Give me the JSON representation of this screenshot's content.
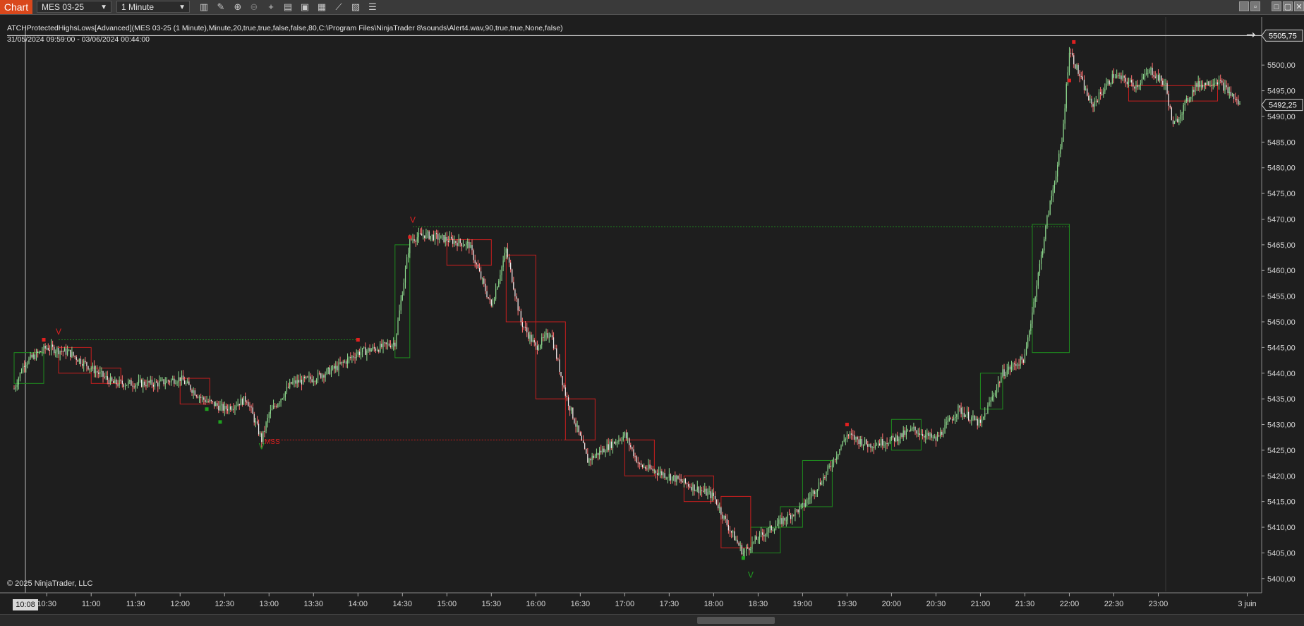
{
  "toolbar": {
    "tab_label": "Chart",
    "instrument": "MES 03-25",
    "interval": "1 Minute",
    "icons": [
      "bar-type-icon",
      "draw-pencil-icon",
      "zoom-in-icon",
      "zoom-out-icon",
      "crosshair-icon",
      "data-box-icon",
      "properties-icon",
      "indicators-icon",
      "strategies-icon",
      "templates-icon",
      "chart-trader-icon"
    ],
    "window_buttons": [
      "minimize-icon",
      "restore-icon",
      "maximize-icon",
      "close-icon"
    ]
  },
  "indicator_label": "ATCHProtectedHighsLows[Advanced](MES 03-25 (1 Minute),Minute,20,true,true,false,false,80,C:\\Program Files\\NinjaTrader 8\\sounds\\Alert4.wav,90,true,true,None,false)",
  "range_label": "31/05/2024 09:59:00 - 03/06/2024 00:44:00",
  "copyright": "© 2025 NinjaTrader, LLC",
  "cursor_time": "10:08",
  "colors": {
    "background": "#1e1e1e",
    "grid": "#2c2c2c",
    "up_candle": "#8fdc8f",
    "down_candle": "#f0f0f0",
    "bull_box": "#1e8c1e",
    "bear_box": "#c81e1e",
    "marker_red": "#e02020",
    "marker_green": "#20a020"
  },
  "chart_data": {
    "type": "candlestick",
    "x_ticks": [
      "10:30",
      "11:00",
      "11:30",
      "12:00",
      "12:30",
      "13:00",
      "13:30",
      "14:00",
      "14:30",
      "15:00",
      "15:30",
      "16:00",
      "16:30",
      "17:00",
      "17:30",
      "18:00",
      "18:30",
      "19:00",
      "19:30",
      "20:00",
      "20:30",
      "21:00",
      "21:30",
      "22:00",
      "22:30",
      "23:00",
      "3 juin"
    ],
    "x_start": "10:08",
    "y_ticks": [
      5400,
      5405,
      5410,
      5415,
      5420,
      5425,
      5430,
      5435,
      5440,
      5445,
      5450,
      5455,
      5460,
      5465,
      5470,
      5475,
      5480,
      5485,
      5490,
      5495,
      5500
    ],
    "y_tick_labels": [
      "5400,00",
      "5405,00",
      "5410,00",
      "5415,00",
      "5420,00",
      "5425,00",
      "5430,00",
      "5435,00",
      "5440,00",
      "5445,00",
      "5450,00",
      "5455,00",
      "5460,00",
      "5465,00",
      "5470,00",
      "5475,00",
      "5480,00",
      "5485,00",
      "5490,00",
      "5495,00",
      "5500,00"
    ],
    "ylim": [
      5397.5,
      5508
    ],
    "price_markers": [
      {
        "label": "5505,75",
        "value": 5505.75
      },
      {
        "label": "5492,25",
        "value": 5492.25
      }
    ],
    "price_path": [
      [
        "10:08",
        5437
      ],
      [
        "10:15",
        5442
      ],
      [
        "10:30",
        5445
      ],
      [
        "10:45",
        5444
      ],
      [
        "11:00",
        5441
      ],
      [
        "11:15",
        5438
      ],
      [
        "11:30",
        5438
      ],
      [
        "11:45",
        5438
      ],
      [
        "12:00",
        5439
      ],
      [
        "12:15",
        5435
      ],
      [
        "12:30",
        5433
      ],
      [
        "12:45",
        5435
      ],
      [
        "12:55",
        5427
      ],
      [
        "13:00",
        5432
      ],
      [
        "13:15",
        5438
      ],
      [
        "13:30",
        5439
      ],
      [
        "13:45",
        5441
      ],
      [
        "14:00",
        5444
      ],
      [
        "14:15",
        5445
      ],
      [
        "14:25",
        5446
      ],
      [
        "14:35",
        5466
      ],
      [
        "14:45",
        5467
      ],
      [
        "15:00",
        5466
      ],
      [
        "15:15",
        5465
      ],
      [
        "15:30",
        5453
      ],
      [
        "15:40",
        5464
      ],
      [
        "15:50",
        5450
      ],
      [
        "16:00",
        5445
      ],
      [
        "16:10",
        5448
      ],
      [
        "16:20",
        5436
      ],
      [
        "16:35",
        5423
      ],
      [
        "16:45",
        5425
      ],
      [
        "17:00",
        5428
      ],
      [
        "17:10",
        5422
      ],
      [
        "17:30",
        5420
      ],
      [
        "17:45",
        5418
      ],
      [
        "18:00",
        5416
      ],
      [
        "18:10",
        5410
      ],
      [
        "18:20",
        5405
      ],
      [
        "18:30",
        5408
      ],
      [
        "18:45",
        5411
      ],
      [
        "19:00",
        5414
      ],
      [
        "19:15",
        5420
      ],
      [
        "19:30",
        5428
      ],
      [
        "19:45",
        5426
      ],
      [
        "20:00",
        5427
      ],
      [
        "20:15",
        5429
      ],
      [
        "20:30",
        5427
      ],
      [
        "20:45",
        5433
      ],
      [
        "21:00",
        5430
      ],
      [
        "21:15",
        5440
      ],
      [
        "21:30",
        5443
      ],
      [
        "21:45",
        5470
      ],
      [
        "21:55",
        5485
      ],
      [
        "22:00",
        5503
      ],
      [
        "22:15",
        5492
      ],
      [
        "22:30",
        5498
      ],
      [
        "22:45",
        5496
      ],
      [
        "22:55",
        5499
      ],
      [
        "23:05",
        5496
      ],
      [
        "23:10",
        5488
      ],
      [
        "23:25",
        5496
      ],
      [
        "23:40",
        5497
      ],
      [
        "23:50",
        5494
      ],
      [
        "23:55",
        5492.25
      ]
    ],
    "bull_boxes": [
      {
        "from": "10:08",
        "to": "10:28",
        "low": 5438,
        "high": 5444
      },
      {
        "from": "14:25",
        "to": "14:35",
        "low": 5443,
        "high": 5465
      },
      {
        "from": "18:25",
        "to": "18:45",
        "low": 5405,
        "high": 5410
      },
      {
        "from": "18:45",
        "to": "19:00",
        "low": 5410,
        "high": 5414
      },
      {
        "from": "19:00",
        "to": "19:20",
        "low": 5414,
        "high": 5423
      },
      {
        "from": "20:00",
        "to": "20:20",
        "low": 5425,
        "high": 5431
      },
      {
        "from": "21:00",
        "to": "21:15",
        "low": 5433,
        "high": 5440
      },
      {
        "from": "21:35",
        "to": "22:00",
        "low": 5444,
        "high": 5469
      }
    ],
    "bear_boxes": [
      {
        "from": "10:38",
        "to": "11:00",
        "low": 5440,
        "high": 5445
      },
      {
        "from": "11:00",
        "to": "11:20",
        "low": 5438,
        "high": 5441
      },
      {
        "from": "12:00",
        "to": "12:20",
        "low": 5434,
        "high": 5439
      },
      {
        "from": "15:00",
        "to": "15:30",
        "low": 5461,
        "high": 5466
      },
      {
        "from": "15:40",
        "to": "16:00",
        "low": 5450,
        "high": 5463
      },
      {
        "from": "16:00",
        "to": "16:20",
        "low": 5435,
        "high": 5450
      },
      {
        "from": "16:20",
        "to": "16:40",
        "low": 5427,
        "high": 5435
      },
      {
        "from": "17:00",
        "to": "17:20",
        "low": 5420,
        "high": 5427
      },
      {
        "from": "17:40",
        "to": "18:00",
        "low": 5415,
        "high": 5420
      },
      {
        "from": "18:05",
        "to": "18:25",
        "low": 5406,
        "high": 5416
      },
      {
        "from": "22:40",
        "to": "23:40",
        "low": 5493,
        "high": 5496
      }
    ],
    "levels": [
      {
        "from": "10:38",
        "to": "14:00",
        "value": 5446.5,
        "color": "bull"
      },
      {
        "from": "14:37",
        "to": "22:00",
        "value": 5468.5,
        "color": "bull"
      },
      {
        "from": "12:55",
        "to": "16:20",
        "value": 5427,
        "color": "bear"
      }
    ],
    "annotations": [
      {
        "text": "V",
        "time": "10:38",
        "value": 5447.5,
        "color": "bear"
      },
      {
        "text": "V",
        "time": "14:37",
        "value": 5469.3,
        "color": "bear"
      },
      {
        "text": "V",
        "time": "12:55",
        "value": 5425.2,
        "color": "bull"
      },
      {
        "text": "V",
        "time": "18:25",
        "value": 5400.2,
        "color": "bull"
      },
      {
        "text": "MSS",
        "time": "12:57",
        "value": 5426.2,
        "color": "bear"
      }
    ],
    "dots": [
      {
        "time": "10:28",
        "value": 5446.5,
        "color": "bear"
      },
      {
        "time": "14:00",
        "value": 5446.5,
        "color": "bear"
      },
      {
        "time": "14:35",
        "value": 5466.5,
        "color": "bear"
      },
      {
        "time": "19:30",
        "value": 5430,
        "color": "bear"
      },
      {
        "time": "22:00",
        "value": 5497,
        "color": "bear"
      },
      {
        "time": "22:03",
        "value": 5504.5,
        "color": "bear"
      },
      {
        "time": "12:18",
        "value": 5433,
        "color": "bull"
      },
      {
        "time": "12:27",
        "value": 5430.5,
        "color": "bull"
      },
      {
        "time": "18:20",
        "value": 5404,
        "color": "bull"
      }
    ]
  }
}
